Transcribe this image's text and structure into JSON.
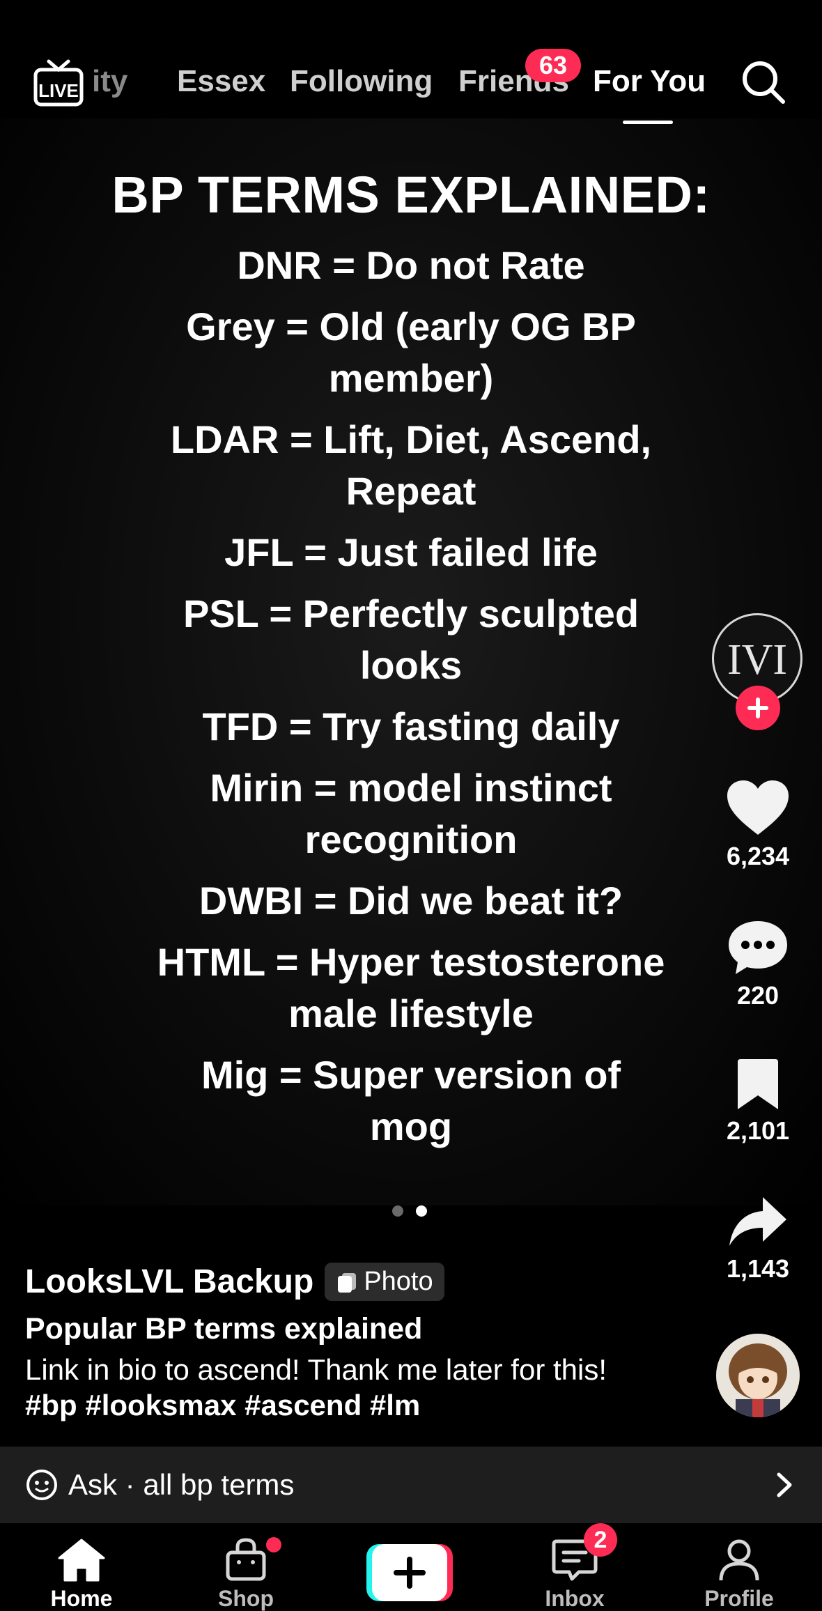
{
  "top_nav": {
    "live_label": "LIVE",
    "tabs": [
      {
        "label": "ity",
        "state": "faded"
      },
      {
        "label": "Essex",
        "state": "inactive"
      },
      {
        "label": "Following",
        "state": "inactive"
      },
      {
        "label": "Friends",
        "state": "inactive",
        "badge": "63"
      },
      {
        "label": "For You",
        "state": "active"
      }
    ],
    "search_icon": "search-icon"
  },
  "post": {
    "title": "BP TERMS EXPLAINED:",
    "terms": [
      "DNR = Do not Rate",
      "Grey = Old (early OG BP member)",
      "LDAR = Lift, Diet, Ascend, Repeat",
      "JFL = Just failed life",
      "PSL = Perfectly sculpted looks",
      "TFD = Try fasting daily",
      "Mirin = model instinct recognition",
      "DWBI = Did we beat it?",
      "HTML = Hyper testosterone male lifestyle",
      "Mig = Super version of mog"
    ],
    "slide_count": 2,
    "active_slide": 2
  },
  "rail": {
    "author_avatar_text": "IVI",
    "likes": "6,234",
    "comments": "220",
    "saves": "2,101",
    "shares": "1,143"
  },
  "caption": {
    "author": "LooksLVL Backup",
    "chip_label": "Photo",
    "title": "Popular BP terms explained",
    "body": "Link in bio to ascend! Thank me later for this!",
    "hashtags": "#bp #looksmax #ascend #lm"
  },
  "ask_bar": {
    "text": "Ask · all bp terms"
  },
  "bottom_nav": {
    "home": "Home",
    "shop": "Shop",
    "inbox": "Inbox",
    "inbox_badge": "2",
    "profile": "Profile"
  },
  "colors": {
    "accent": "#fe2c55",
    "cyan": "#25f4ee",
    "background": "#000000"
  }
}
